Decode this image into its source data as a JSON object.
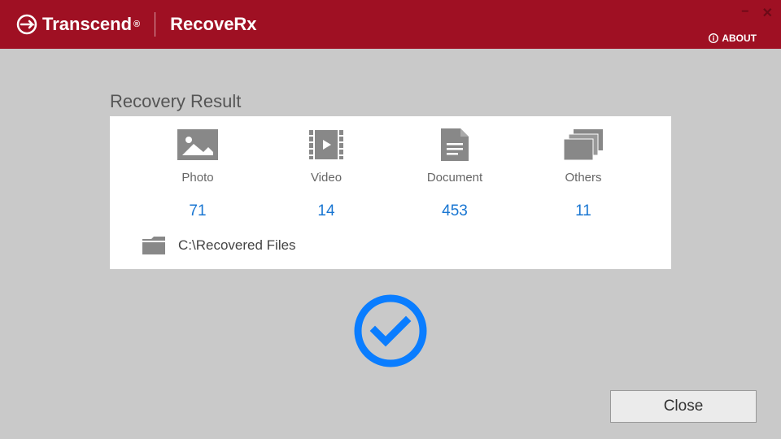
{
  "header": {
    "brand": "Transcend",
    "product": "RecoveRx",
    "about": "ABOUT"
  },
  "panel": {
    "title": "Recovery Result",
    "categories": [
      {
        "label": "Photo",
        "count": 71
      },
      {
        "label": "Video",
        "count": 14
      },
      {
        "label": "Document",
        "count": 453
      },
      {
        "label": "Others",
        "count": 11
      }
    ],
    "path": "C:\\Recovered Files"
  },
  "close": "Close"
}
